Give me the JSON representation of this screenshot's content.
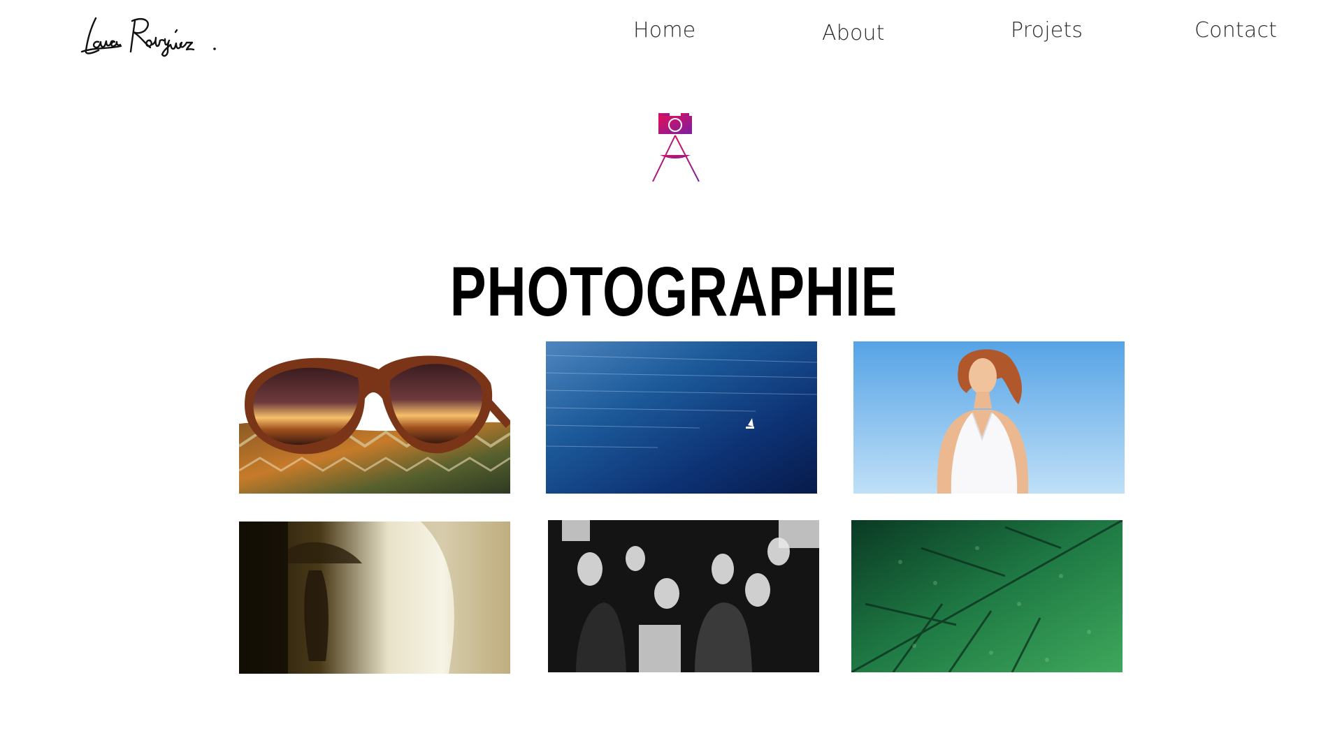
{
  "logo": {
    "text": "Laura Rodriguez.",
    "icon": "signature-logo"
  },
  "nav": {
    "items": [
      {
        "label": "Home"
      },
      {
        "label": "About"
      },
      {
        "label": "Projets"
      },
      {
        "label": "Contact"
      }
    ]
  },
  "hero": {
    "icon": "camera-tripod-icon",
    "title": "PHOTOGRAPHIE"
  },
  "colors": {
    "accent_start": "#d1145a",
    "accent_end": "#7a1fa2",
    "title": "#000000",
    "nav_text": "#2a2a2a"
  },
  "gallery": {
    "items": [
      {
        "subject": "sunglasses-photo"
      },
      {
        "subject": "ocean-sailboat-photo"
      },
      {
        "subject": "woman-portrait-photo"
      },
      {
        "subject": "umbrella-silhouette-photo"
      },
      {
        "subject": "black-white-crowd-photo"
      },
      {
        "subject": "green-leaf-photo"
      }
    ]
  }
}
